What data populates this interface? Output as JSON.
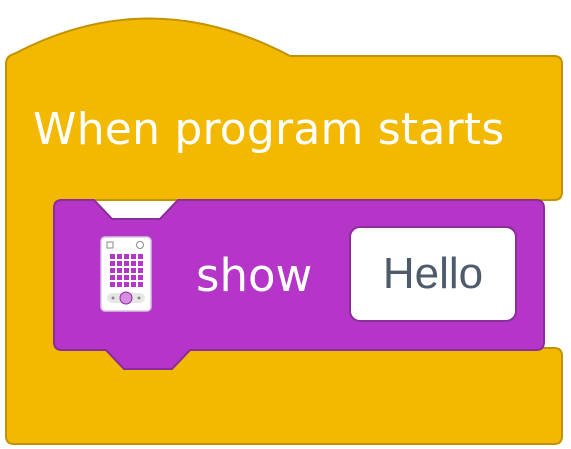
{
  "hat_block": {
    "title": "When program starts",
    "color": "#f2b900",
    "border_color": "#c49200"
  },
  "command_block": {
    "label": "show",
    "icon": "matrix-display-icon",
    "color": "#b535c8",
    "border_color": "#8b2d9a",
    "input_value": "Hello"
  }
}
